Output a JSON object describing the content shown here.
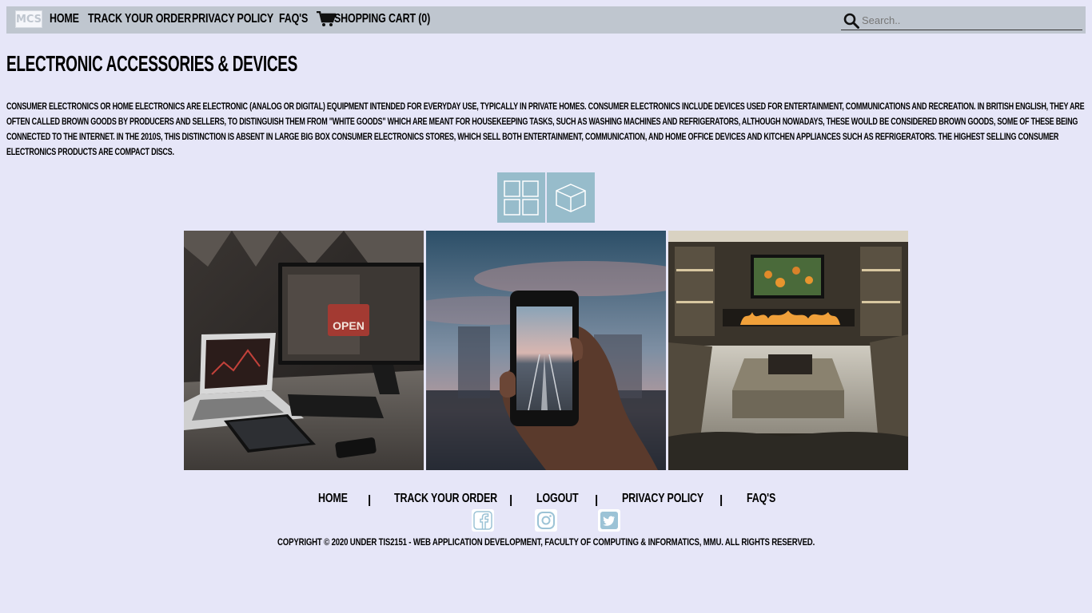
{
  "nav": {
    "logo_text": "MCS",
    "home": "HOME",
    "track": "TRACK YOUR ORDER",
    "privacy": "PRIVACY POLICY",
    "faq": "FAQ'S",
    "cart": "SHOPPING CART (0)",
    "search_placeholder": "Search.."
  },
  "page": {
    "title": "ELECTRONIC ACCESSORIES & DEVICES",
    "intro": "CONSUMER ELECTRONICS OR HOME ELECTRONICS ARE ELECTRONIC (ANALOG OR DIGITAL) EQUIPMENT INTENDED FOR EVERYDAY USE, TYPICALLY IN PRIVATE HOMES. CONSUMER ELECTRONICS INCLUDE DEVICES USED FOR ENTERTAINMENT, COMMUNICATIONS AND RECREATION. IN BRITISH ENGLISH, THEY ARE OFTEN CALLED BROWN GOODS BY PRODUCERS AND SELLERS, TO DISTINGUISH THEM FROM \"WHITE GOODS\" WHICH ARE MEANT FOR HOUSEKEEPING TASKS, SUCH AS WASHING MACHINES AND REFRIGERATORS, ALTHOUGH NOWADAYS, THESE WOULD BE CONSIDERED BROWN GOODS, SOME OF THESE BEING CONNECTED TO THE INTERNET. IN THE 2010S, THIS DISTINCTION IS ABSENT IN LARGE BIG BOX CONSUMER ELECTRONICS STORES, WHICH SELL BOTH ENTERTAINMENT, COMMUNICATION, AND HOME OFFICE DEVICES AND KITCHEN APPLIANCES SUCH AS REFRIGERATORS. THE HIGHEST SELLING CONSUMER ELECTRONICS PRODUCTS ARE COMPACT DISCS.",
    "photo_sign_text": "OPEN"
  },
  "footer": {
    "home": "HOME",
    "track": "TRACK YOUR ORDER",
    "logout": "LOGOUT",
    "privacy": "PRIVACY POLICY",
    "faq": "FAQ'S",
    "separator": "|",
    "copyright": "COPYRIGHT © 2020 UNDER TIS2151 - WEB APPLICATION DEVELOPMENT, FACULTY OF COMPUTING & INFORMATICS, MMU. ALL RIGHTS RESERVED."
  },
  "colors": {
    "background": "#e6e6f8",
    "navbar": "#bfc6cf",
    "toggle": "#97bccb",
    "social_icon": "#9cc3d6"
  },
  "icons": [
    "cart-icon",
    "search-icon",
    "grid-view-icon",
    "3d-box-view-icon",
    "facebook-icon",
    "instagram-icon",
    "twitter-icon"
  ]
}
